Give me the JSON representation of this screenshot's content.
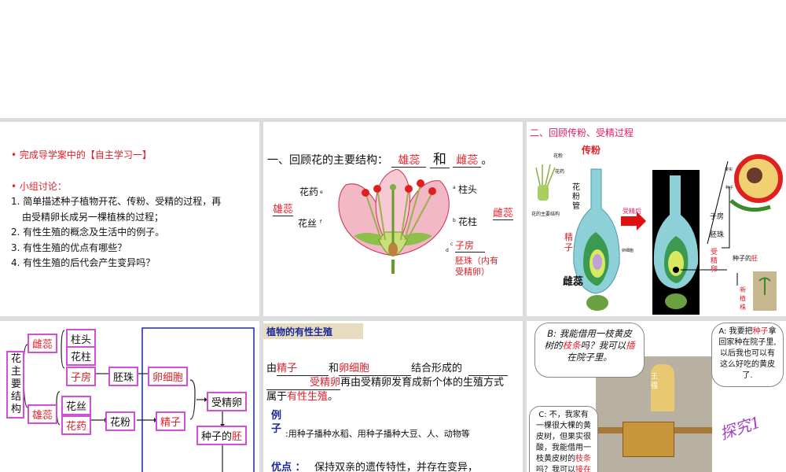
{
  "panel1": {
    "bullet1": "完成导学案中的【自主学习一】",
    "bullet2": "小组讨论：",
    "items": [
      "1. 简单描述种子植物开花、传粉、受精的过程，再",
      "由受精卵长成另一棵植株的过程；",
      "2. 有性生殖的概念及生活中的例子。",
      "3. 有性生殖的优点有哪些？",
      "4. 有性生殖的后代会产生变异吗？"
    ]
  },
  "panel2": {
    "heading": "一、回顾花的主要结构：",
    "answer1": "雄蕊",
    "and": "和",
    "answer2": "雌蕊",
    "period": "。",
    "labels": {
      "anther": "花药",
      "filament": "花丝",
      "stamen": "雄蕊",
      "stigma": "柱头",
      "style": "花柱",
      "pistil": "雌蕊",
      "ovary": "子房",
      "ovule": "胚珠（内有",
      "ovule2": "受精卵）"
    },
    "letters": [
      "a",
      "b",
      "c",
      "d",
      "e",
      "f"
    ]
  },
  "panel3": {
    "title": "二、回顾传粉、受精过程",
    "pollination": "传粉",
    "pollen": "花粉",
    "anther": "花药",
    "flower_caption": "花的主要结构",
    "pollen_tube": "花\n粉\n管",
    "sperm": "精\n子",
    "egg": "卵细胞",
    "pistil": "雌蕊",
    "after": "受精后",
    "ovary": "子房",
    "ovule": "胚珠",
    "fruit": "果实",
    "seed": "种子",
    "zygote": "受\n精\n卵",
    "embryo_prefix": "种子的",
    "embryo": "胚",
    "new_plant": "新\n植\n株"
  },
  "panel4": {
    "root": "花主要结构",
    "pistil": "雌蕊",
    "stamen": "雄蕊",
    "stigma": "柱头",
    "style": "花柱",
    "ovary": "子房",
    "filament": "花丝",
    "anther": "花药",
    "ovule": "胚珠",
    "pollen": "花粉",
    "egg": "卵细胞",
    "sperm": "精子",
    "zygote": "受精卵",
    "embryo_prefix": "种子的",
    "embryo": "胚"
  },
  "panel5": {
    "title": "植物的有性生殖",
    "l1a": "由",
    "l1b": "精子",
    "l1c": "和",
    "l1d": "卵细胞",
    "l1e": "结合形成的",
    "l2a": "受精卵",
    "l2b": "再由受精卵发育成新个体的生殖方式",
    "l3a": "属于",
    "l3b": "有性生殖",
    "l3c": "。",
    "example_label": "例\n子",
    "example": ":用种子播种水稻、用种子播种大豆、人、动物等",
    "adv_label": "优点 ：",
    "adv": "保持双亲的遗传特性，并存在变异，"
  },
  "panel6": {
    "b1": "B: 我能借用一枝黄皮",
    "b2a": "树的",
    "b2b": "枝条",
    "b2c": "吗？我可以",
    "b2d": "插",
    "b3": "在院子里。",
    "a1a": "A: 我要把",
    "a1b": "种子",
    "a1c": "拿",
    "a2": "回家种在院子里,",
    "a3": "以后我也可以有",
    "a4": "这么好吃的黄皮",
    "a5": "了.",
    "c1": "C: 不，我家有",
    "c2": "一棵很大棵的黄",
    "c3": "皮树，但果实很",
    "c4": "酸，我能借用一",
    "c5a": "枝黄皮树的",
    "c5b": "枝条",
    "c6a": "吗？我可以",
    "c6b": "接在",
    "name": "王\n强",
    "explore": "探究1"
  }
}
